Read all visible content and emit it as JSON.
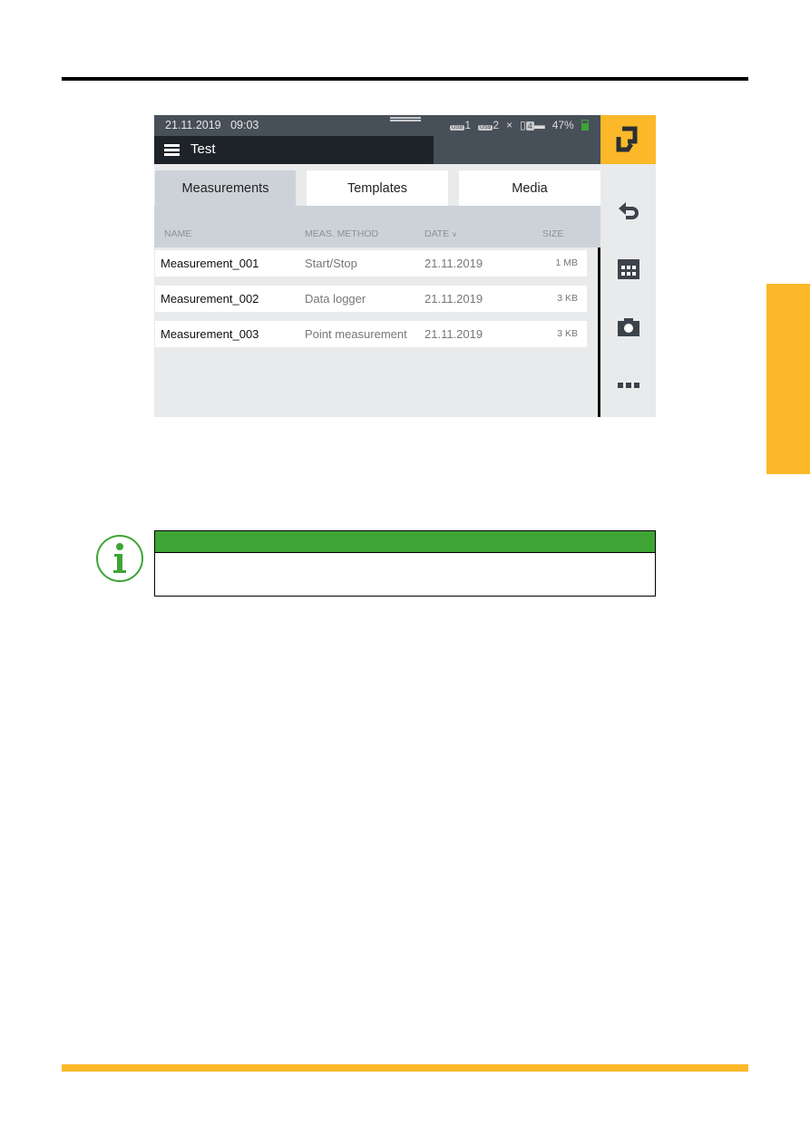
{
  "status_bar": {
    "date": "21.11.2019",
    "time": "09:03",
    "usb1": "USB",
    "usb1_num": "1",
    "usb2": "USB",
    "usb2_num": "2",
    "close_symbol": "×",
    "channel": "4",
    "battery": "47%",
    "battery_level": 47
  },
  "title_bar": {
    "title": "Test"
  },
  "tabs": [
    {
      "label": "Measurements",
      "active": true
    },
    {
      "label": "Templates",
      "active": false
    },
    {
      "label": "Media",
      "active": false
    }
  ],
  "table": {
    "headers": {
      "name": "NAME",
      "method": "MEAS. METHOD",
      "date": "DATE",
      "date_sort": "∨",
      "size": "SIZE"
    },
    "rows": [
      {
        "name": "Measurement_001",
        "method": "Start/Stop",
        "date": "21.11.2019",
        "size": "1 MB"
      },
      {
        "name": "Measurement_002",
        "method": "Data logger",
        "date": "21.11.2019",
        "size": "3 KB"
      },
      {
        "name": "Measurement_003",
        "method": "Point measurement",
        "date": "21.11.2019",
        "size": "3 KB"
      }
    ]
  },
  "sidebar": {
    "icons": [
      "export-icon",
      "undo-icon",
      "calendar-icon",
      "camera-icon",
      "more-icon"
    ]
  },
  "colors": {
    "accent": "#fbb829",
    "note_green": "#3ea535",
    "header_dark": "#474f58",
    "title_dark": "#1e2329"
  }
}
